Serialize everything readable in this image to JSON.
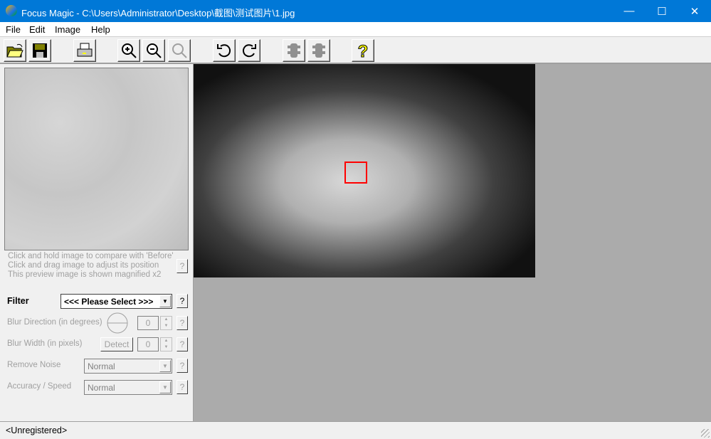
{
  "window": {
    "title": "Focus Magic - C:\\Users\\Administrator\\Desktop\\截图\\测试图片\\1.jpg",
    "minimize": "—",
    "maximize": "☐",
    "close": "✕"
  },
  "menu": [
    "File",
    "Edit",
    "Image",
    "Help"
  ],
  "toolbar": [
    "open-folder-icon",
    "save-disk-icon",
    "print-icon",
    "zoom-in-icon",
    "zoom-out-icon",
    "zoom-fit-icon",
    "rotate-left-icon",
    "rotate-right-icon",
    "traffic-light-icon",
    "traffic-light-icon",
    "help-icon"
  ],
  "preview": {
    "hints": [
      "Click and hold image to compare with 'Before'",
      "Click and drag image to adjust its position",
      "This preview image is shown magnified x2"
    ],
    "help": "?"
  },
  "controls": {
    "filter_label": "Filter",
    "filter_value": "<<< Please Select >>>",
    "blur_direction_label": "Blur Direction (in degrees)",
    "blur_direction_value": "0",
    "blur_width_label": "Blur Width (in pixels)",
    "detect_label": "Detect",
    "blur_width_value": "0",
    "remove_noise_label": "Remove Noise",
    "remove_noise_value": "Normal",
    "accuracy_label": "Accuracy / Speed",
    "accuracy_value": "Normal",
    "help": "?"
  },
  "status": "<Unregistered>"
}
